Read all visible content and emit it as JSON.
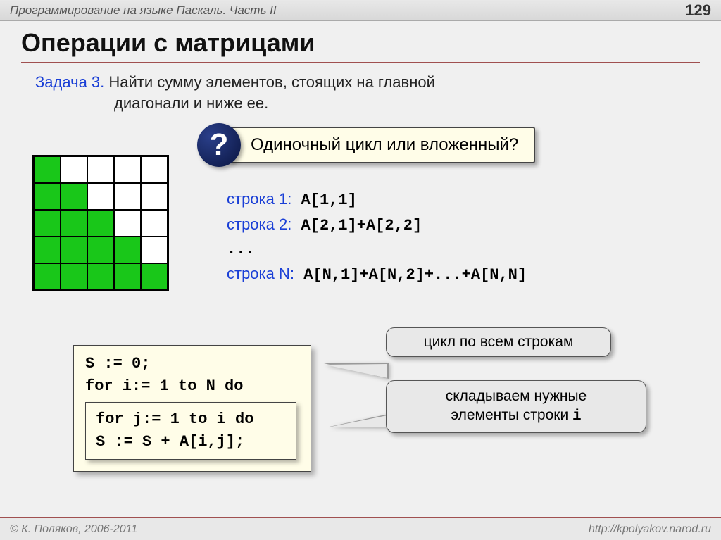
{
  "header": {
    "subject": "Программирование на языке Паскаль. Часть II",
    "page": "129"
  },
  "title": "Операции с матрицами",
  "task": {
    "label": "Задача 3.",
    "line1": " Найти сумму элементов, стоящих  на главной",
    "line2": "диагонали и ниже ее."
  },
  "question": {
    "mark": "?",
    "text": "Одиночный цикл или вложенный?"
  },
  "matrix_fill": [
    [
      1,
      0,
      0,
      0,
      0
    ],
    [
      1,
      1,
      0,
      0,
      0
    ],
    [
      1,
      1,
      1,
      0,
      0
    ],
    [
      1,
      1,
      1,
      1,
      0
    ],
    [
      1,
      1,
      1,
      1,
      1
    ]
  ],
  "rows": {
    "r1_label": "строка 1:",
    "r1_code": " A[1,1]",
    "r2_label": "строка 2:",
    "r2_code": " A[2,1]+A[2,2]",
    "dots": "...",
    "rn_label": "строка N:",
    "rn_code": " A[N,1]+A[N,2]+...+A[N,N]"
  },
  "code": {
    "l1": "S := 0;",
    "l2": "for i:= 1 to N do",
    "l3": "for j:= 1 to i do",
    "l4": "  S := S + A[i,j];"
  },
  "callouts": {
    "c1": "цикл по всем строкам",
    "c2a": "складываем нужные",
    "c2b": "элементы строки ",
    "c2c": "i"
  },
  "footer": {
    "left": "© К. Поляков, 2006-2011",
    "right": "http://kpolyakov.narod.ru"
  }
}
